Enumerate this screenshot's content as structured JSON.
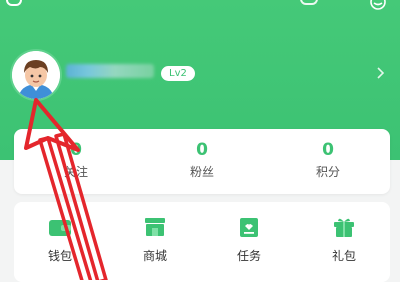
{
  "profile": {
    "level_badge": "Lv2"
  },
  "stats": [
    {
      "value": "0",
      "label": "关注"
    },
    {
      "value": "0",
      "label": "粉丝"
    },
    {
      "value": "0",
      "label": "积分"
    }
  ],
  "menu": [
    {
      "label": "钱包",
      "icon": "wallet-icon"
    },
    {
      "label": "商城",
      "icon": "store-icon"
    },
    {
      "label": "任务",
      "icon": "task-icon"
    },
    {
      "label": "礼包",
      "icon": "gift-icon"
    }
  ],
  "colors": {
    "brand": "#3cc273",
    "annotation": "#e4262c"
  }
}
